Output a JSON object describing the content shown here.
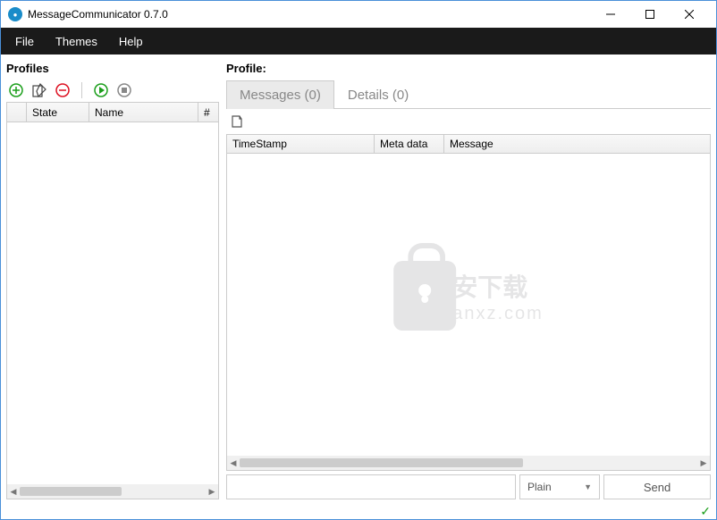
{
  "window": {
    "title": "MessageCommunicator 0.7.0"
  },
  "menu": {
    "file": "File",
    "themes": "Themes",
    "help": "Help"
  },
  "left": {
    "header": "Profiles",
    "columns": {
      "blank": "",
      "state": "State",
      "name": "Name",
      "hash": "#"
    }
  },
  "right": {
    "header": "Profile:",
    "tabs": {
      "messages": "Messages (0)",
      "details": "Details (0)"
    },
    "msg_columns": {
      "timestamp": "TimeStamp",
      "metadata": "Meta data",
      "message": "Message"
    },
    "format_select": "Plain",
    "send": "Send"
  },
  "watermark": {
    "cn": "安下载",
    "en": "anxz.com"
  },
  "status": {
    "ok": "✓"
  }
}
